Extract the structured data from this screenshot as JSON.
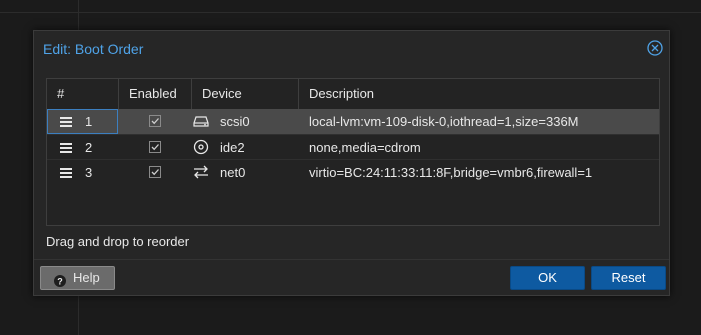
{
  "dialog": {
    "title": "Edit: Boot Order",
    "hint": "Drag and drop to reorder"
  },
  "grid": {
    "headers": {
      "num": "#",
      "enabled": "Enabled",
      "device": "Device",
      "description": "Description"
    },
    "rows": [
      {
        "num": "1",
        "enabled": true,
        "device": "scsi0",
        "icon": "hard-drive-icon",
        "description": "local-lvm:vm-109-disk-0,iothread=1,size=336M"
      },
      {
        "num": "2",
        "enabled": true,
        "device": "ide2",
        "icon": "cdrom-icon",
        "description": "none,media=cdrom"
      },
      {
        "num": "3",
        "enabled": true,
        "device": "net0",
        "icon": "network-exchange-icon",
        "description": "virtio=BC:24:11:33:11:8F,bridge=vmbr6,firewall=1"
      }
    ]
  },
  "buttons": {
    "help": "Help",
    "ok": "OK",
    "reset": "Reset"
  },
  "colors": {
    "title": "#4fa3e8",
    "primary_button": "#0e5aa1",
    "selected_row": "#4a4a4a"
  }
}
